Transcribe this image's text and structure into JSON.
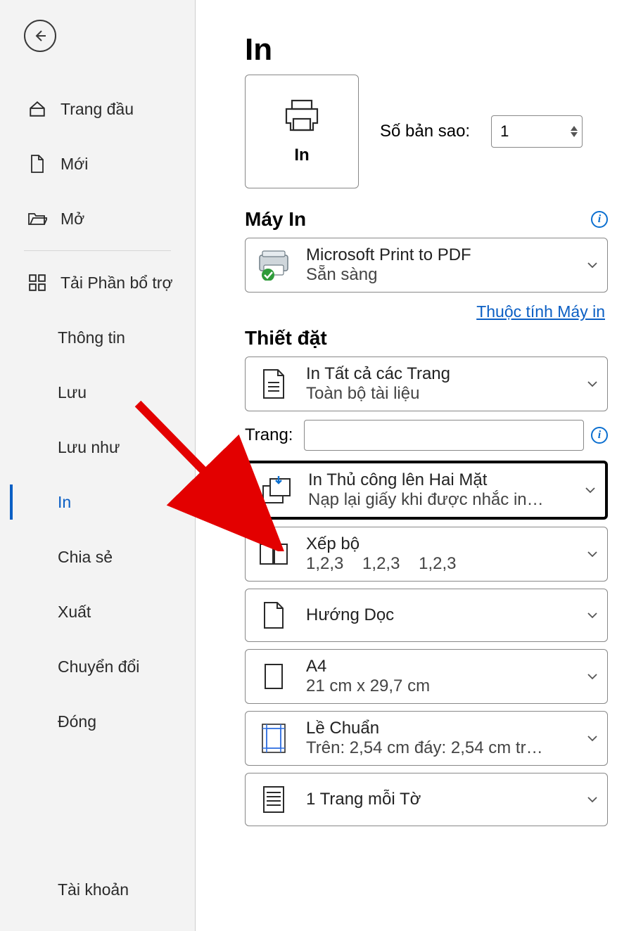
{
  "sidebar": {
    "home": "Trang đầu",
    "new": "Mới",
    "open": "Mở",
    "addins": "Tải Phần bổ trợ",
    "info": "Thông tin",
    "save": "Lưu",
    "save_as": "Lưu như",
    "print": "In",
    "share": "Chia sẻ",
    "export": "Xuất",
    "transform": "Chuyển đổi",
    "close": "Đóng",
    "account": "Tài khoản"
  },
  "page_title": "In",
  "print_button": "In",
  "copies_label": "Số bản sao:",
  "copies_value": "1",
  "printer_section": "Máy In",
  "printer": {
    "name": "Microsoft Print to PDF",
    "status": "Sẵn sàng"
  },
  "printer_properties_link": "Thuộc tính Máy in",
  "settings_section": "Thiết đặt",
  "pages_label": "Trang:",
  "pages_value": "",
  "settings": {
    "what": {
      "primary": "In Tất cả các Trang",
      "secondary": "Toàn bộ tài liệu"
    },
    "duplex": {
      "primary": "In Thủ công lên Hai Mặt",
      "secondary": "Nạp lại giấy khi được nhắc in…"
    },
    "collate": {
      "primary": "Xếp bộ",
      "secondary": "1,2,3    1,2,3    1,2,3"
    },
    "orientation": {
      "primary": "Hướng Dọc"
    },
    "paper": {
      "primary": "A4",
      "secondary": "21 cm x 29,7 cm"
    },
    "margins": {
      "primary": "Lề Chuẩn",
      "secondary": "Trên: 2,54 cm đáy: 2,54 cm tr…"
    },
    "per_sheet": {
      "primary": "1 Trang mỗi Tờ"
    }
  }
}
